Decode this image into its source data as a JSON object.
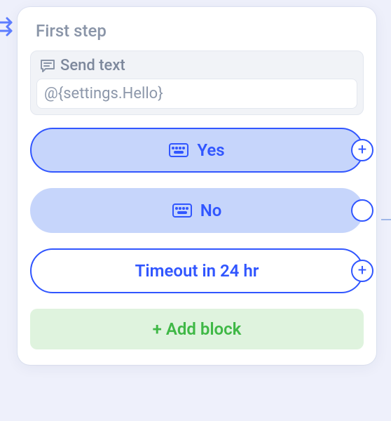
{
  "card": {
    "title": "First step"
  },
  "send": {
    "header_label": "Send text",
    "value": "@{settings.Hello}"
  },
  "options": [
    {
      "label": "Yes",
      "port": "plus"
    },
    {
      "label": "No",
      "port": "empty"
    },
    {
      "label": "Timeout in 24 hr",
      "port": "plus"
    }
  ],
  "add_block": {
    "label": "+ Add block"
  }
}
